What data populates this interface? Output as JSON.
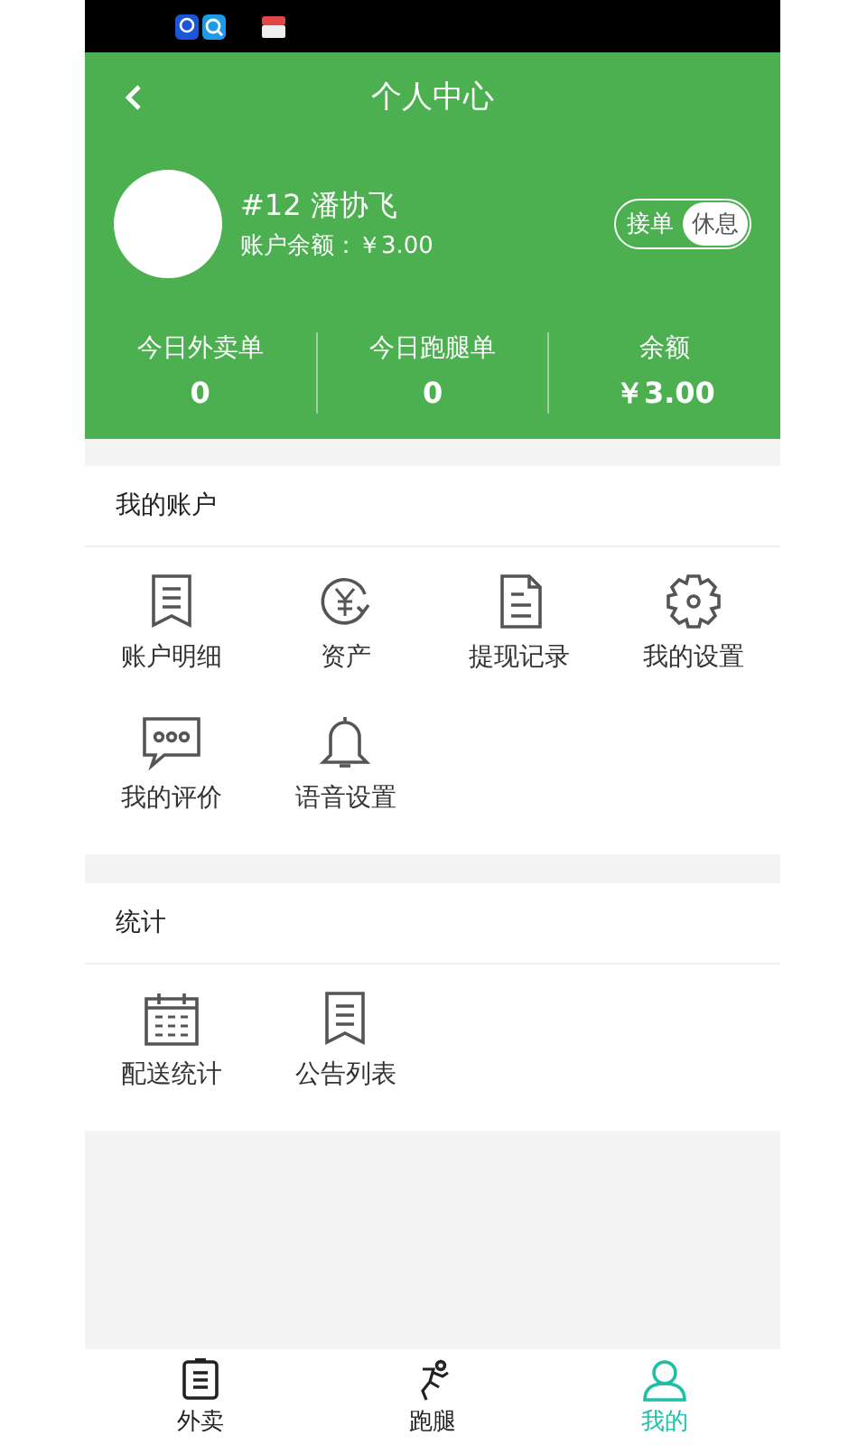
{
  "nav": {
    "title": "个人中心"
  },
  "profile": {
    "name": "#12 潘协飞",
    "balance_label": "账户余额：",
    "balance": "￥3.00",
    "status_toggle": [
      {
        "label": "接单",
        "selected": false
      },
      {
        "label": "休息",
        "selected": true
      }
    ]
  },
  "stats": [
    {
      "label": "今日外卖单",
      "value": "0"
    },
    {
      "label": "今日跑腿单",
      "value": "0"
    },
    {
      "label": "余额",
      "value": "￥3.00"
    }
  ],
  "sections": [
    {
      "title": "我的账户",
      "items": [
        {
          "label": "账户明细",
          "kind": "receipt"
        },
        {
          "label": "资产",
          "kind": "yen"
        },
        {
          "label": "提现记录",
          "kind": "document"
        },
        {
          "label": "我的设置",
          "kind": "gear"
        },
        {
          "label": "我的评价",
          "kind": "chat"
        },
        {
          "label": "语音设置",
          "kind": "bell"
        }
      ]
    },
    {
      "title": "统计",
      "items": [
        {
          "label": "配送统计",
          "kind": "calendar"
        },
        {
          "label": "公告列表",
          "kind": "receipt"
        }
      ]
    }
  ],
  "tab_bar": [
    {
      "label": "外卖",
      "kind": "clipboard",
      "selected": false
    },
    {
      "label": "跑腿",
      "kind": "runner",
      "selected": false
    },
    {
      "label": "我的",
      "kind": "person",
      "selected": true
    }
  ]
}
